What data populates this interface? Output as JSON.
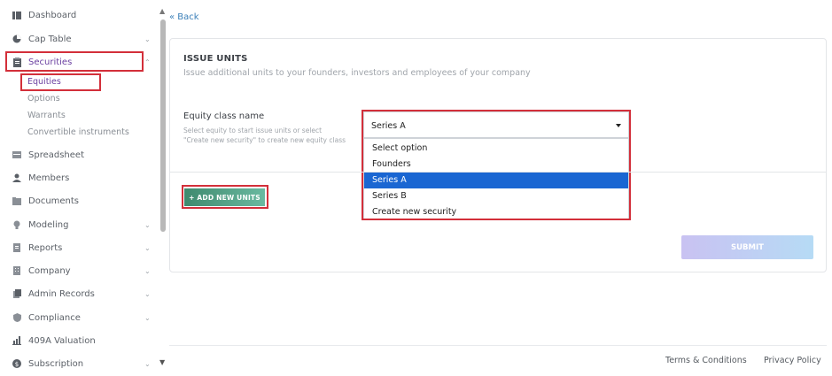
{
  "sidebar": {
    "items": [
      {
        "label": "Dashboard",
        "icon": "dashboard-icon",
        "glyph": "▤"
      },
      {
        "label": "Cap Table",
        "icon": "pie-chart-icon",
        "glyph": "◔",
        "chevron": "⌄"
      },
      {
        "label": "Securities",
        "icon": "clipboard-icon",
        "glyph": "▥",
        "chevron": "⌃"
      },
      {
        "label": "Spreadsheet",
        "icon": "spreadsheet-icon",
        "glyph": "▦"
      },
      {
        "label": "Members",
        "icon": "person-icon",
        "glyph": "●"
      },
      {
        "label": "Documents",
        "icon": "folder-icon",
        "glyph": "■"
      },
      {
        "label": "Modeling",
        "icon": "bulb-icon",
        "glyph": "●",
        "chevron": "⌄"
      },
      {
        "label": "Reports",
        "icon": "report-icon",
        "glyph": "▣",
        "chevron": "⌄"
      },
      {
        "label": "Company",
        "icon": "building-icon",
        "glyph": "▣",
        "chevron": "⌄"
      },
      {
        "label": "Admin Records",
        "icon": "records-icon",
        "glyph": "▣",
        "chevron": "⌄"
      },
      {
        "label": "Compliance",
        "icon": "shield-icon",
        "glyph": "◆",
        "chevron": "⌄"
      },
      {
        "label": "409A Valuation",
        "icon": "chart-icon",
        "glyph": "▲"
      },
      {
        "label": "Subscription",
        "icon": "dollar-icon",
        "glyph": "●",
        "chevron": "⌄"
      }
    ],
    "sub_items": [
      "Equities",
      "Options",
      "Warrants",
      "Convertible instruments"
    ]
  },
  "main": {
    "back_label": "« Back",
    "title": "ISSUE UNITS",
    "subtitle": "Issue additional units to your founders, investors and employees of your company",
    "field_label": "Equity class name",
    "field_help_1": "Select equity to start issue units or select",
    "field_help_2": "\"Create new security\" to create new equity class",
    "select_value": "Series A",
    "options": [
      "Select option",
      "Founders",
      "Series A",
      "Series B",
      "Create new security"
    ],
    "selected_option": "Series A",
    "add_button": "+ ADD NEW UNITS",
    "submit_button": "SUBMIT"
  },
  "footer": {
    "terms": "Terms & Conditions",
    "privacy": "Privacy Policy"
  },
  "colors": {
    "accent": "#3a7fb8",
    "highlight": "#d32f3a",
    "selected_option": "#1a66d2",
    "active_nav": "#6a3fa0"
  }
}
